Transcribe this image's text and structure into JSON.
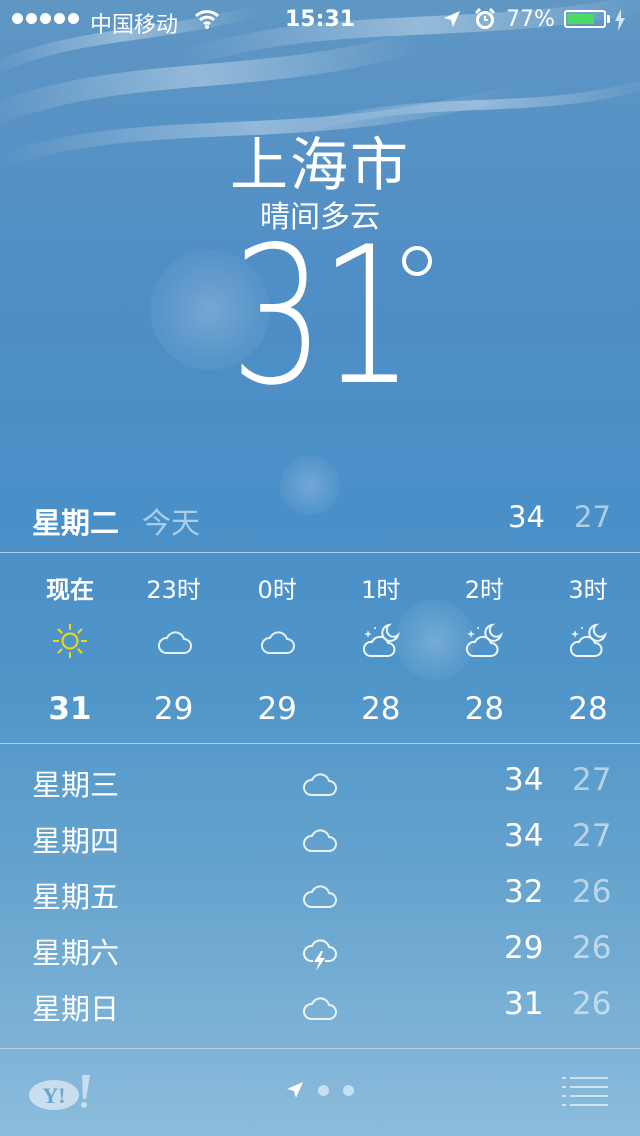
{
  "status_bar": {
    "carrier": "中国移动",
    "time": "15:31",
    "battery": "77%",
    "battery_level": 0.77,
    "icons": [
      "signal-dots",
      "wifi-icon",
      "location-arrow-icon",
      "alarm-icon",
      "battery-icon",
      "charging-icon"
    ]
  },
  "header": {
    "city": "上海市",
    "condition": "晴间多云",
    "temperature": "31"
  },
  "today": {
    "day": "星期二",
    "label": "今天",
    "high": "34",
    "low": "27"
  },
  "hourly": [
    {
      "time": "现在",
      "icon": "sun-icon",
      "temp": "31"
    },
    {
      "time": "23时",
      "icon": "cloud-icon",
      "temp": "29"
    },
    {
      "time": "0时",
      "icon": "cloud-icon",
      "temp": "29"
    },
    {
      "time": "1时",
      "icon": "partly-cloudy-night-icon",
      "temp": "28"
    },
    {
      "time": "2时",
      "icon": "partly-cloudy-night-icon",
      "temp": "28"
    },
    {
      "time": "3时",
      "icon": "partly-cloudy-night-icon",
      "temp": "28"
    }
  ],
  "daily": [
    {
      "day": "星期三",
      "icon": "cloud-icon",
      "high": "34",
      "low": "27"
    },
    {
      "day": "星期四",
      "icon": "cloud-icon",
      "high": "34",
      "low": "27"
    },
    {
      "day": "星期五",
      "icon": "cloud-icon",
      "high": "32",
      "low": "26"
    },
    {
      "day": "星期六",
      "icon": "thunderstorm-icon",
      "high": "29",
      "low": "26"
    },
    {
      "day": "星期日",
      "icon": "cloud-icon",
      "high": "31",
      "low": "26"
    }
  ],
  "footer": {
    "logo": "Y!",
    "page_count": 2,
    "current_page": "location"
  },
  "colors": {
    "sun": "#f5d90a",
    "battery_fill": "#4cd964",
    "text": "#ffffff"
  }
}
